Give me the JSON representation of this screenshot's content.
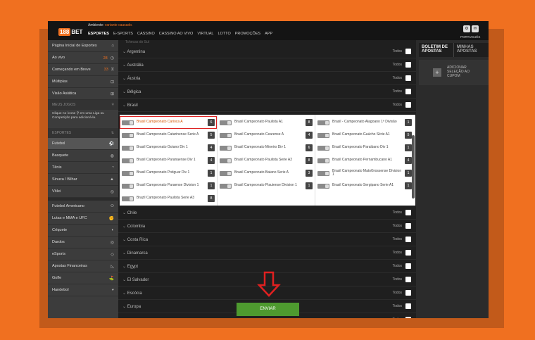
{
  "header": {
    "message_prefix": "Ambiente:",
    "message_highlight": "variante causado.",
    "nav": [
      "ESPORTES",
      "E-SPORTS",
      "CASSINO",
      "CASSINO AO VIVO",
      "VIRTUAL",
      "LOTTO",
      "PROMOÇÕES",
      "APP"
    ],
    "language": "PORTUGUÊS",
    "logo_num": "188",
    "logo_text": "BET"
  },
  "leftnav": {
    "items_top": [
      {
        "label": "Página Inicial de Esportes",
        "icon": "home-icon",
        "glyph": "⌂"
      },
      {
        "label": "Ao vivo",
        "count": "28",
        "icon": "clock-icon",
        "glyph": "◷"
      },
      {
        "label": "Começando em Breve",
        "count": "33",
        "icon": "timer-icon",
        "glyph": "⧖"
      },
      {
        "label": "Múltiplas",
        "icon": "multiples-icon",
        "glyph": "⊡"
      },
      {
        "label": "Visão Asiática",
        "icon": "asian-view-icon",
        "glyph": "⊞"
      }
    ],
    "meus_jogos": "MEUS JOGOS",
    "hint": "Clique no ícone ⚲ em uma Liga ou Competição para adicioná-la.",
    "esportes": "ESPORTES",
    "sports": [
      {
        "label": "Futebol",
        "icon": "soccer-icon",
        "glyph": "⚽"
      },
      {
        "label": "Basquete",
        "icon": "basketball-icon",
        "glyph": "◍"
      },
      {
        "label": "Tênis",
        "icon": "tennis-icon",
        "glyph": "◔"
      },
      {
        "label": "Sinuca / Bilhar",
        "icon": "snooker-icon",
        "glyph": "▲"
      },
      {
        "label": "Vôlei",
        "icon": "volleyball-icon",
        "glyph": "◎"
      }
    ],
    "sports2": [
      {
        "label": "Futebol Americano",
        "icon": "american-football-icon",
        "glyph": "⬭"
      },
      {
        "label": "Lutas e MMA e UFC",
        "icon": "mma-icon",
        "glyph": "✊"
      },
      {
        "label": "Críquete",
        "icon": "cricket-icon",
        "glyph": "◐"
      },
      {
        "label": "Dardos",
        "icon": "darts-icon",
        "glyph": "◎"
      },
      {
        "label": "eSports",
        "icon": "esports-icon",
        "glyph": "◇"
      },
      {
        "label": "Apostas Financeiras",
        "icon": "finance-icon",
        "glyph": "◺"
      },
      {
        "label": "Golfe",
        "icon": "golf-icon",
        "glyph": "⛳"
      },
      {
        "label": "Handebol",
        "icon": "handball-icon",
        "glyph": "◕"
      }
    ]
  },
  "main": {
    "cut_label": "Tchecas do Sul",
    "todos": "Todos",
    "countries_top": [
      "Argentina",
      "Austrália",
      "Áustria",
      "Bélgica",
      "Brasil"
    ],
    "brasil_cols": [
      [
        {
          "name": "Brasil Campeonato Carioca A",
          "n": "6",
          "selected": true
        },
        {
          "name": "Brasil Campeonato Catarinense Serie A",
          "n": "5"
        },
        {
          "name": "Brasil Campeonato Goiano Div 1",
          "n": "4"
        },
        {
          "name": "Brasil Campeonato Paranaense Div 1",
          "n": "4"
        },
        {
          "name": "Brasil Campeonato Potiguar Div 1",
          "n": "1"
        },
        {
          "name": "Brasil Campeonato Paraense Division 1",
          "n": "1"
        },
        {
          "name": "Brazil Campeonato Paulista Serie A3",
          "n": "8"
        }
      ],
      [
        {
          "name": "Brasil Campeonato Paulista A1",
          "n": "8"
        },
        {
          "name": "Brasil Campeonato Cearense A",
          "n": "4"
        },
        {
          "name": "Brasil Campeonato Mineiro Div 1",
          "n": "6"
        },
        {
          "name": "Brasil Campeonato Paulista Serie A2",
          "n": "8"
        },
        {
          "name": "Brasil Campeonato Baiano Serie A",
          "n": "3"
        },
        {
          "name": "Brasil Campeonato Piauiense Division 1",
          "n": "1"
        }
      ],
      [
        {
          "name": "Brasil - Campeonato Alagoano 1ª Divisão",
          "n": "1"
        },
        {
          "name": "Brasil Campeonato Gaúcho Série A1",
          "n": "5"
        },
        {
          "name": "Brasil Campeonato Paraibano Div 1",
          "n": "1"
        },
        {
          "name": "Brasil Campeonato Pernambucano A1",
          "n": "4"
        },
        {
          "name": "Brasil Campeonato MatoGrossense Division 1",
          "n": "1"
        },
        {
          "name": "Brasil Campeonato Sergipano Serie A1",
          "n": "1"
        }
      ]
    ],
    "countries_bottom": [
      "Chile",
      "Colombia",
      "Costa Rica",
      "Dinamarca",
      "Egypt",
      "El Salvador",
      "Escócia",
      "Europa",
      "França"
    ],
    "send_button": "ENVIAR"
  },
  "right": {
    "tab1": "BOLETIM DE APOSTAS",
    "tab2": "MINHAS APOSTAS",
    "coupon_text": "ADICIONAR SELEÇÃO AO CUPOM"
  },
  "colors": {
    "accent": "#f07020",
    "send": "#4e9a2f",
    "highlight_outline": "#dd2222"
  }
}
